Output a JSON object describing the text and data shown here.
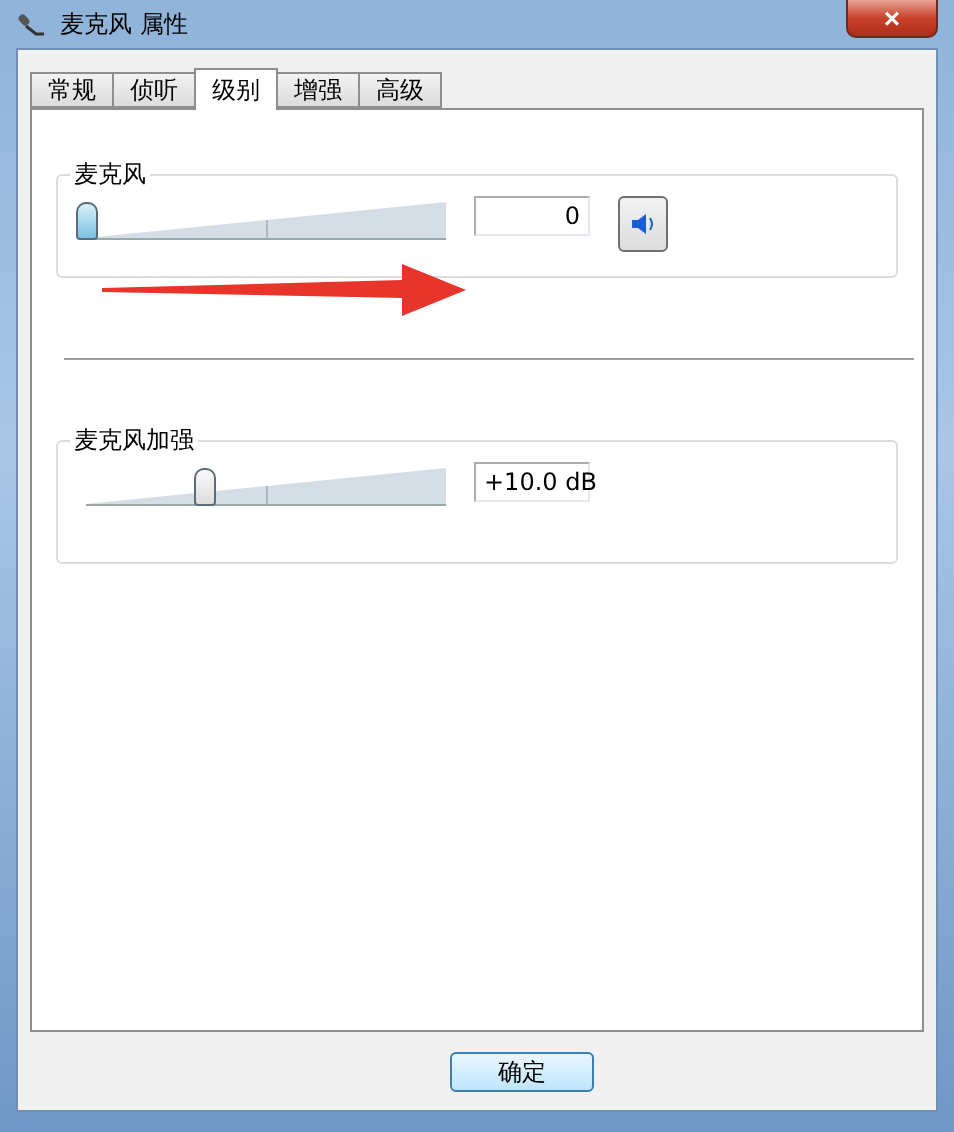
{
  "window": {
    "title": "麦克风 属性",
    "close": "×"
  },
  "tabs": [
    {
      "label": "常规",
      "selected": false
    },
    {
      "label": "侦听",
      "selected": false
    },
    {
      "label": "级别",
      "selected": true
    },
    {
      "label": "增强",
      "selected": false
    },
    {
      "label": "高级",
      "selected": false
    }
  ],
  "groups": [
    {
      "title": "麦克风",
      "level": 0,
      "value": "0",
      "kind": "volume"
    },
    {
      "title": "麦克风加强",
      "level": 0.33,
      "value": "+10.0 dB",
      "kind": "boost"
    }
  ],
  "buttons": [
    "确定"
  ]
}
